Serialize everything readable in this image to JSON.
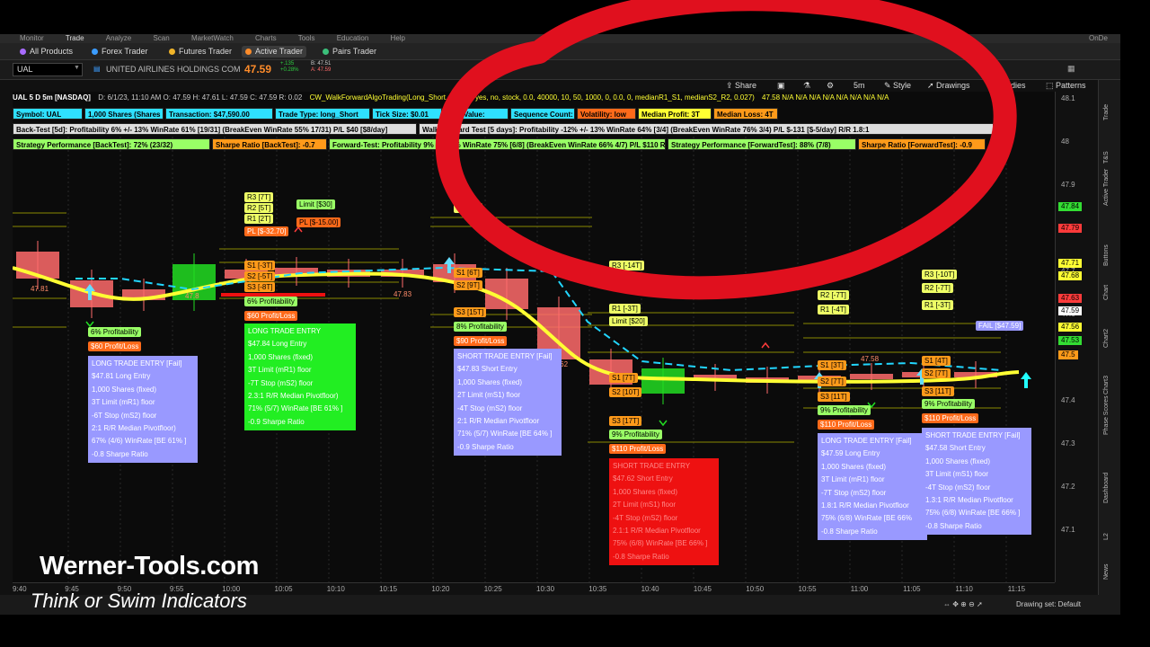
{
  "nav": {
    "top_items": [
      "Monitor",
      "Trade",
      "Analyze",
      "Scan",
      "MarketWatch",
      "Charts",
      "Tools",
      "Education",
      "Help"
    ],
    "top_right": "OnDe",
    "sub_items": [
      {
        "label": "All Products",
        "color": "#a86bff"
      },
      {
        "label": "Forex Trader",
        "color": "#3b9cff"
      },
      {
        "label": "Futures Trader",
        "color": "#f0b429"
      },
      {
        "label": "Active Trader",
        "color": "#ff8c2a"
      },
      {
        "label": "Pairs Trader",
        "color": "#3bbf7a"
      }
    ]
  },
  "symbol": {
    "ticker": "UAL",
    "name": "UNITED AIRLINES HOLDINGS COM",
    "last": "47.59",
    "change": "+.135",
    "change_pct": "+0.28%",
    "bid": "B: 47.51",
    "ask": "A: 47.59"
  },
  "toolbar": {
    "share": "Share",
    "timeframe": "5m",
    "style": "Style",
    "drawings": "Drawings",
    "studies": "Studies",
    "patterns": "Patterns"
  },
  "header": {
    "title": "UAL 5 D 5m [NASDAQ]",
    "ohlc": "D: 6/1/23, 11:10 AM   O: 47.59   H: 47.61   L: 47.59   C: 47.59   R: 0.02",
    "study": "CW_WalkForwardAlgoTrading(Long_Short, 2, floor, yes, no, stock, 0.0, 40000, 10, 50, 1000, 0, 0.0, 0, medianR1_S1, medianS2_R2, 0.027)",
    "tail": "47.58   N/A   N/A   N/A   N/A   N/A   N/A   N/A   N/A"
  },
  "info_rows": [
    [
      {
        "text": "Symbol: UAL",
        "bg": "#2fe0ff",
        "fg": "#000"
      },
      {
        "text": "1,000 Shares (Shares",
        "bg": "#2fe0ff",
        "fg": "#000"
      },
      {
        "text": "Transaction: $47,590.00",
        "bg": "#2fe0ff",
        "fg": "#000"
      },
      {
        "text": "Trade Type: long_Short",
        "bg": "#2fe0ff",
        "fg": "#000"
      },
      {
        "text": "Tick Size: $0.01",
        "bg": "#2fe0ff",
        "fg": "#000"
      },
      {
        "text": "Tick Value:",
        "bg": "#2fe0ff",
        "fg": "#000"
      },
      {
        "text": "Sequence Count: 2",
        "bg": "#2fe0ff",
        "fg": "#000"
      },
      {
        "text": "Volatility: low",
        "bg": "#ff6a1a",
        "fg": "#000"
      },
      {
        "text": "Median Profit: 3T",
        "bg": "#ffff33",
        "fg": "#000"
      },
      {
        "text": "Median Loss: 4T",
        "bg": "#ff9a1a",
        "fg": "#000"
      }
    ],
    [
      {
        "text": "Back-Test [5d]: Profitability 6% +/- 13%  WinRate 61% [19/31] (BreakEven WinRate 55% 17/31) P/L $40 [$8/day]",
        "bg": "#dddddd",
        "fg": "#000"
      },
      {
        "text": "Walk-Forward Test [5 days]: Profitability -12% +/- 13%  WinRate 64% [3/4] (BreakEven WinRate 76% 3/4) P/L $-131 [$-5/day] R/R 1.8:1",
        "bg": "#dddddd",
        "fg": "#000"
      }
    ],
    [
      {
        "text": "Strategy Performance [BackTest]: 72% (23/32)",
        "bg": "#99ff66",
        "fg": "#000"
      },
      {
        "text": "Sharpe Ratio [BackTest]: -0.7",
        "bg": "#ff9a1a",
        "fg": "#000"
      },
      {
        "text": "Forward-Test: Profitability 9% +/- 13% WinRate 75% [6/8] (BreakEven WinRate 66% 4/7) P/L $110  R/R 1.9:1",
        "bg": "#99ff66",
        "fg": "#000"
      },
      {
        "text": "Strategy Performance [ForwardTest]: 88% (7/8)",
        "bg": "#99ff66",
        "fg": "#000"
      },
      {
        "text": "Sharpe Ratio [ForwardTest]: -0.9",
        "bg": "#ff9a1a",
        "fg": "#000"
      }
    ]
  ],
  "y_ticks": [
    "48.1",
    "48",
    "47.9",
    "47.8",
    "47.7",
    "47.6",
    "47.5",
    "47.4",
    "47.3",
    "47.2",
    "47.1"
  ],
  "y_badges": [
    {
      "text": "47.84",
      "color": "#33dd33"
    },
    {
      "text": "47.79",
      "color": "#ff3b3b"
    },
    {
      "text": "47.71",
      "color": "#ffff33"
    },
    {
      "text": "47.68",
      "color": "#ffff33"
    },
    {
      "text": "47.63",
      "color": "#ff3b3b"
    },
    {
      "text": "47.59",
      "color": "#ffffff"
    },
    {
      "text": "47.56",
      "color": "#ffff33"
    },
    {
      "text": "47.53",
      "color": "#33dd33"
    },
    {
      "text": "47.5",
      "color": "#ff9a1a"
    }
  ],
  "x_ticks": [
    "9:40",
    "9:45",
    "9:50",
    "9:55",
    "10:00",
    "10:05",
    "10:10",
    "10:15",
    "10:20",
    "10:25",
    "10:30",
    "10:35",
    "10:40",
    "10:45",
    "10:50",
    "10:55",
    "11:00",
    "11:05",
    "11:10",
    "11:15"
  ],
  "price_labels": [
    "47.81",
    "47.8",
    "47.83",
    "47.62",
    "47.58"
  ],
  "level_labels": {
    "set1_r": [
      "R3 [7T]",
      "R2 [5T]",
      "R1 [2T]"
    ],
    "set1_s": [
      "S1 [-3T]",
      "S2 [-5T]",
      "S3 [-8T]"
    ],
    "set1_extra": [
      "Limit [$30]",
      "PL [$-15.00]",
      "PL [$-32.70]"
    ],
    "set2_r": [
      "R1 [..T]"
    ],
    "set2_s": [
      "S1 [6T]",
      "S2 [9T]",
      "S3 [15T]"
    ],
    "set3_r": [
      "R3 [-14T]",
      "R1 [-3T]",
      "Limit [$20]"
    ],
    "set3_s": [
      "S1 [7T]",
      "S2 [10T]",
      "S3 [17T]"
    ],
    "set4_r": [
      "R2 [-7T]",
      "R1 [-4T]"
    ],
    "set4_s": [
      "S1 [3T]",
      "S2 [7T]",
      "S3 [11T]"
    ],
    "set5_r": [
      "R3 [-10T]",
      "R2 [-7T]",
      "R1 [-3T]"
    ],
    "set5_s": [
      "S1 [4T]",
      "S2 [7T]",
      "S3 [11T]"
    ],
    "fail_tag": "FAIL [$47.59]"
  },
  "small_tags": [
    {
      "text": "6% Profitability",
      "bg": "#99ff66"
    },
    {
      "text": "$60 Profit/Loss",
      "bg": "#ff6a1a"
    },
    {
      "text": "6% Profitability",
      "bg": "#99ff66"
    },
    {
      "text": "$60 Profit/Loss",
      "bg": "#ff6a1a"
    },
    {
      "text": "8% Profitability",
      "bg": "#99ff66"
    },
    {
      "text": "$90 Profit/Loss",
      "bg": "#ff6a1a"
    },
    {
      "text": "9% Profitability",
      "bg": "#99ff66"
    },
    {
      "text": "$110 Profit/Loss",
      "bg": "#ff6a1a"
    },
    {
      "text": "9% Profitability",
      "bg": "#99ff66"
    },
    {
      "text": "$110 Profit/Loss",
      "bg": "#ff6a1a"
    },
    {
      "text": "9% Profitability",
      "bg": "#99ff66"
    },
    {
      "text": "$110 Profit/Loss",
      "bg": "#ff6a1a"
    }
  ],
  "trade_boxes": [
    {
      "bg": "#9999ff",
      "lines": [
        "LONG TRADE ENTRY [Fail]",
        "$47.81 Long Entry",
        "1,000 Shares  (fixed)",
        "3T  Limit (mR1) floor",
        "-6T  Stop (mS2) floor",
        "2:1 R/R Median Pivotfloor)",
        "67% (4/6) WinRate [BE 61% ]",
        "-0.8 Sharpe Ratio"
      ]
    },
    {
      "bg": "#22ee22",
      "lines": [
        "LONG TRADE ENTRY",
        "$47.84 Long Entry",
        "1,000 Shares  (fixed)",
        "3T  Limit (mR1) floor",
        "-7T  Stop (mS2) floor",
        "2.3:1 R/R Median Pivotfloor)",
        "71% (5/7) WinRate [BE 61% ]",
        "-0.9 Sharpe Ratio"
      ]
    },
    {
      "bg": "#9999ff",
      "lines": [
        "SHORT TRADE ENTRY [Fail]",
        "$47.83 Short Entry",
        "1,000 Shares  (fixed)",
        "2T  Limit (mS1) floor",
        "-4T  Stop (mS2) floor",
        "2:1 R/R Median Pivotfloor",
        "71% (5/7) WinRate [BE 64% ]",
        "-0.9 Sharpe Ratio"
      ]
    },
    {
      "bg": "#ee1111",
      "lines": [
        "SHORT TRADE ENTRY",
        "$47.62 Short Entry",
        "1,000 Shares  (fixed)",
        "2T  Limit (mS1) floor",
        "-4T  Stop (mS2) floor",
        "2.1:1 R/R Median Pivotfloor",
        "75% (6/8) WinRate [BE 66% ]",
        "-0.8 Sharpe Ratio"
      ]
    },
    {
      "bg": "#9999ff",
      "lines": [
        "LONG TRADE ENTRY [Fail]",
        "$47.59 Long Entry",
        "1,000 Shares  (fixed)",
        "3T  Limit (mR1) floor",
        "-7T  Stop (mS2) floor",
        "1.8:1 R/R Median Pivotfloor",
        "75% (6/8) WinRate [BE 66%",
        "-0.8 Sharpe Ratio"
      ]
    },
    {
      "bg": "#9999ff",
      "lines": [
        "SHORT TRADE ENTRY [Fail]",
        "$47.58 Short Entry",
        "1,000 Shares  (fixed)",
        "3T  Limit (mS1) floor",
        "-4T  Stop (mS2) floor",
        "1.3:1 R/R Median Pivotfloor",
        "75% (6/8) WinRate [BE 66% ]",
        "-0.8 Sharpe Ratio"
      ]
    }
  ],
  "side_tabs": [
    "Trade",
    "T&S",
    "Active Trader",
    "Buttons",
    "Chart",
    "Chart2",
    "Chart3",
    "Phase Scores",
    "Dashboard",
    "L2",
    "News"
  ],
  "bottom_bar": {
    "drawing_set": "Drawing set: Default"
  },
  "watermark": {
    "site": "Werner-Tools.com",
    "tagline": "Think or Swim Indicators"
  },
  "colors": {
    "red_circle": "#e0101e",
    "ma_line": "#ffff33",
    "cyan_line": "#22d6ff"
  }
}
